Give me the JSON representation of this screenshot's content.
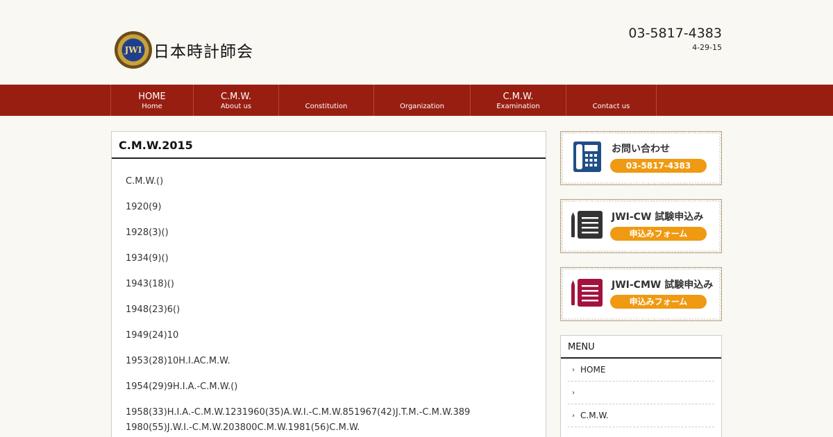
{
  "header": {
    "logo_badge_text": "JWI",
    "logo_text": "日本時計師会",
    "tel": "03-5817-4383",
    "address": "4-29-15"
  },
  "nav": {
    "items": [
      {
        "label": "HOME",
        "sub": "Home"
      },
      {
        "label": "C.M.W.",
        "sub": "About us"
      },
      {
        "label": "",
        "sub": "Constitution"
      },
      {
        "label": "",
        "sub": "Organization"
      },
      {
        "label": "C.M.W.",
        "sub": "Examination"
      },
      {
        "label": "",
        "sub": "Contact us"
      }
    ]
  },
  "main": {
    "title": "C.M.W.2015",
    "paragraphs": [
      "C.M.W.()",
      "1920(9)",
      "1928(3)()",
      "1934(9)()",
      "1943(18)()",
      "1948(23)6()",
      "1949(24)10",
      "1953(28)10H.I.AC.M.W.",
      "1954(29)9H.I.A.-C.M.W.()",
      "1958(33)H.I.A.-C.M.W.1231960(35)A.W.I.-C.M.W.851967(42)J.T.M.-C.M.W.389 1980(55)J.W.I.-C.M.W.203800C.M.W.1981(56)C.M.W."
    ]
  },
  "sidebar": {
    "contact_banner": {
      "title": "お問い合わせ",
      "pill": "03-5817-4383",
      "icon": "telephone-icon",
      "icon_color": "#1f4f86"
    },
    "cw_banner": {
      "title": "JWI-CW 試験申込み",
      "pill": "申込みフォーム",
      "icon": "document-form-icon",
      "icon_color": "#333333"
    },
    "cmw_banner": {
      "title": "JWI-CMW 試験申込み",
      "pill": "申込みフォーム",
      "icon": "document-form-icon",
      "icon_color": "#a3123e"
    },
    "menu": {
      "title": "MENU",
      "items": [
        {
          "label": "HOME"
        },
        {
          "label": ""
        },
        {
          "label": "C.M.W."
        }
      ]
    }
  },
  "colors": {
    "nav_background": "#981e12",
    "pill_orange": "#ef9a12",
    "page_background": "#faf8f3"
  }
}
